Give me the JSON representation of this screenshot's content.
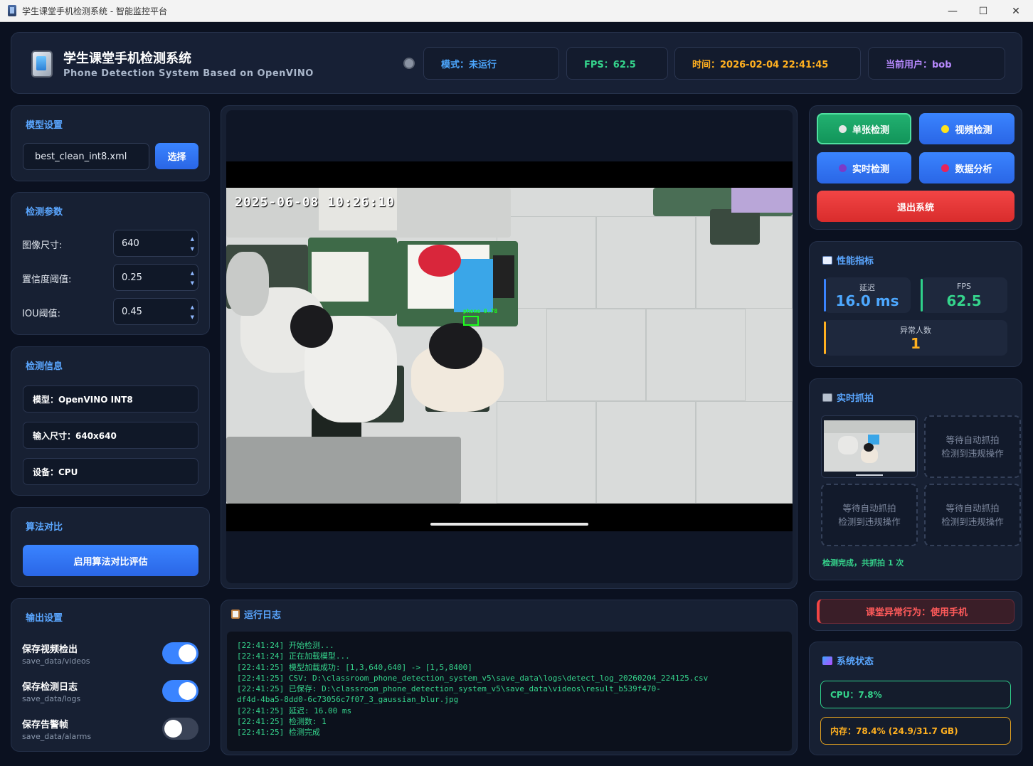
{
  "window": {
    "title": "学生课堂手机检测系统 - 智能监控平台",
    "minimize": "—",
    "maximize": "☐",
    "close": "✕"
  },
  "header": {
    "title": "学生课堂手机检测系统",
    "subtitle": "Phone Detection System Based on OpenVINO",
    "mode": "模式：未运行",
    "fps": "FPS：62.5",
    "time": "时间：2026-02-04 22:41:45",
    "user": "当前用户：bob"
  },
  "model_settings": {
    "title": "模型设置",
    "file": "best_clean_int8.xml",
    "select_label": "选择"
  },
  "detect_params": {
    "title": "检测参数",
    "img_size_label": "图像尺寸:",
    "img_size": "640",
    "conf_label": "置信度阈值:",
    "conf": "0.25",
    "iou_label": "IOU阈值:",
    "iou": "0.45"
  },
  "detect_info": {
    "title": "检测信息",
    "model": "模型：OpenVINO INT8",
    "input_size": "输入尺寸：640x640",
    "device": "设备：CPU"
  },
  "algo_compare": {
    "title": "算法对比",
    "button": "启用算法对比评估"
  },
  "output_settings": {
    "title": "输出设置",
    "items": [
      {
        "label": "保存视频检出",
        "path": "save_data/videos",
        "on": true
      },
      {
        "label": "保存检测日志",
        "path": "save_data/logs",
        "on": true
      },
      {
        "label": "保存告警帧",
        "path": "save_data/alarms",
        "on": false
      }
    ]
  },
  "video": {
    "timestamp": "2025-06-08  10:26:10",
    "detection_label": "phone 0.78"
  },
  "log": {
    "title": "运行日志",
    "lines": "[22:41:24] 开始检测...\n[22:41:24] 正在加载模型...\n[22:41:25] 模型加载成功: [1,3,640,640] -> [1,5,8400]\n[22:41:25] CSV: D:\\classroom_phone_detection_system_v5\\save_data\\logs\\detect_log_20260204_224125.csv\n[22:41:25] 已保存: D:\\classroom_phone_detection_system_v5\\save_data\\videos\\result_b539f470-\ndf4d-4ba5-8dd0-6c73056c7f07_3_gaussian_blur.jpg\n[22:41:25] 延迟: 16.00 ms\n[22:41:25] 检测数: 1\n[22:41:25] 检测完成"
  },
  "actions": {
    "single": "单张检测",
    "video": "视频检测",
    "realtime": "实时检测",
    "analysis": "数据分析",
    "exit": "退出系统"
  },
  "performance": {
    "title": "性能指标",
    "latency_label": "延迟",
    "latency": "16.0 ms",
    "fps_label": "FPS",
    "fps": "62.5",
    "abnormal_label": "异常人数",
    "abnormal": "1"
  },
  "snapshots": {
    "title": "实时抓拍",
    "waiting_line1": "等待自动抓拍",
    "waiting_line2": "检测到违规操作",
    "status": "检测完成，共抓拍 1 次"
  },
  "alert": {
    "text": "课堂异常行为：使用手机"
  },
  "system_status": {
    "title": "系统状态",
    "cpu": "CPU：7.8%",
    "memory": "内存：78.4% (24.9/31.7 GB)"
  },
  "colors": {
    "accent_blue": "#3a84ff",
    "success_green": "#35d48c",
    "warning_orange": "#ffb020",
    "danger_red": "#f24545",
    "user_purple": "#b88aff"
  }
}
